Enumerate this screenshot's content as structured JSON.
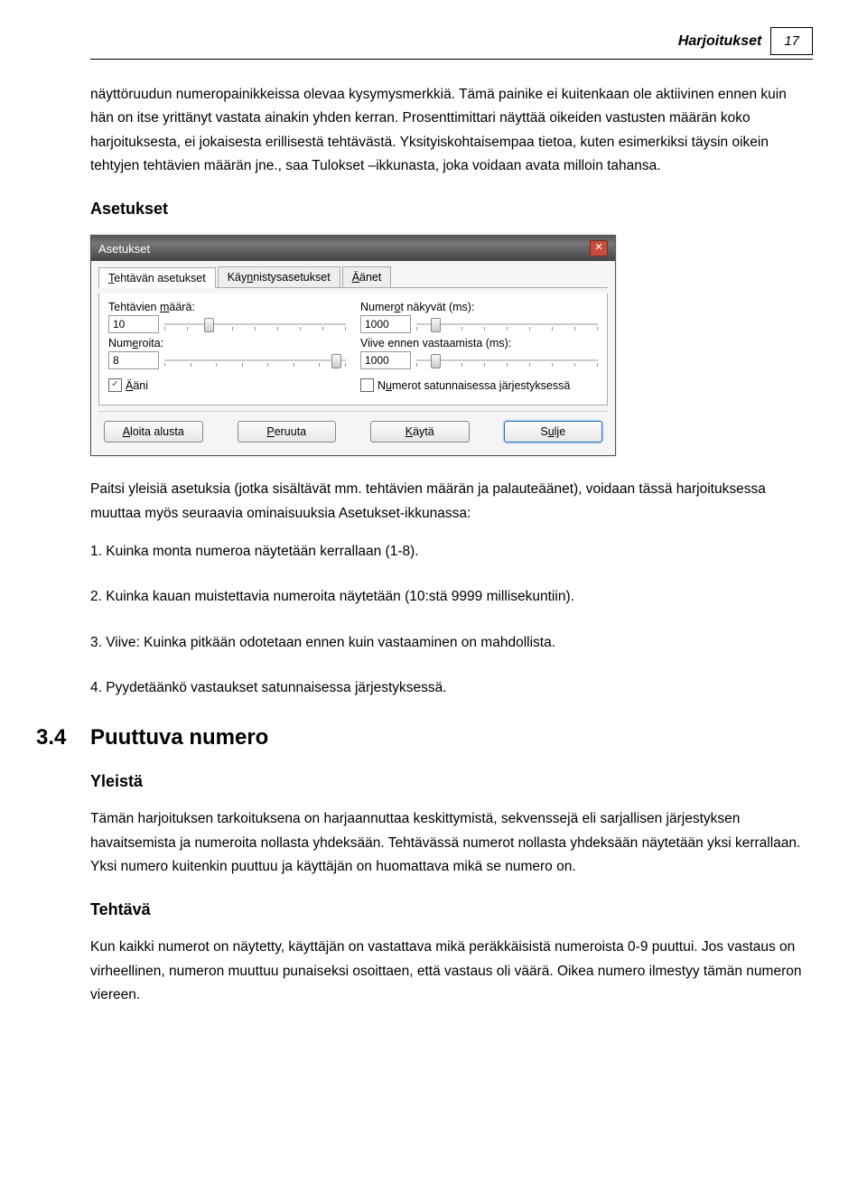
{
  "header": {
    "title": "Harjoitukset",
    "page": "17"
  },
  "para1": "näyttöruudun numeropainikkeissa olevaa kysymysmerkkiä. Tämä painike ei kuitenkaan ole aktiivinen ennen kuin hän on itse yrittänyt vastata ainakin yhden kerran. Prosenttimittari näyttää oikeiden vastusten määrän koko harjoituksesta, ei jokaisesta erillisestä tehtävästä. Yksityiskohtaisempaa tietoa, kuten esimerkiksi täysin oikein tehtyjen tehtävien määrän jne., saa Tulokset –ikkunasta, joka voidaan avata milloin tahansa.",
  "h_asetukset": "Asetukset",
  "dialog": {
    "title": "Asetukset",
    "tabs": [
      "Tehtävän asetukset",
      "Käynnistysasetukset",
      "Äänet"
    ],
    "lbl_tasks": "Tehtävien määrä:",
    "val_tasks": "10",
    "lbl_vis": "Numerot näkyvät (ms):",
    "val_vis": "1000",
    "lbl_digits": "Numeroita:",
    "val_digits": "8",
    "lbl_delay": "Viive ennen vastaamista (ms):",
    "val_delay": "1000",
    "chk_sound": "Ääni",
    "chk_random": "Numerot satunnaisessa järjestyksessä",
    "btn_restart": "Aloita alusta",
    "btn_cancel": "Peruuta",
    "btn_apply": "Käytä",
    "btn_close": "Sulje"
  },
  "para2": "Paitsi yleisiä asetuksia (jotka sisältävät mm. tehtävien määrän ja palauteäänet), voidaan tässä harjoituksessa muuttaa myös seuraavia ominaisuuksia Asetukset-ikkunassa:",
  "li1": "1. Kuinka monta numeroa näytetään kerrallaan (1-8).",
  "li2": "2. Kuinka kauan muistettavia numeroita näytetään (10:stä 9999 millisekuntiin).",
  "li3": "3. Viive: Kuinka pitkään odotetaan ennen kuin vastaaminen on mahdollista.",
  "li4": "4. Pyydetäänkö vastaukset satunnaisessa järjestyksessä.",
  "sec": {
    "num": "3.4",
    "title": "Puuttuva numero"
  },
  "h_yleista": "Yleistä",
  "para3": "Tämän harjoituksen tarkoituksena on harjaannuttaa keskittymistä, sekvenssejä eli sarjallisen järjestyksen havaitsemista ja numeroita nollasta yhdeksään. Tehtävässä numerot nollasta yhdeksään näytetään yksi kerrallaan. Yksi numero kuitenkin puuttuu ja käyttäjän on huomattava mikä se numero on.",
  "h_tehtava": "Tehtävä",
  "para4": "Kun kaikki numerot on näytetty, käyttäjän on vastattava mikä peräkkäisistä numeroista 0-9 puuttui. Jos vastaus on virheellinen, numeron muuttuu punaiseksi osoittaen, että vastaus oli väärä. Oikea numero ilmestyy tämän numeron viereen."
}
